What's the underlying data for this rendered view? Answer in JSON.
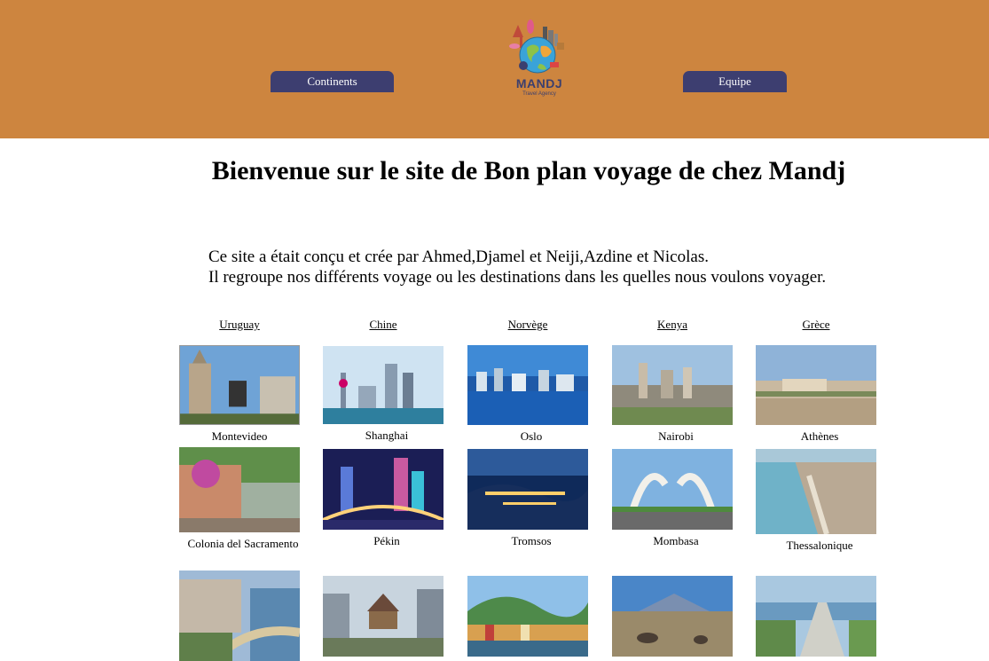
{
  "header": {
    "bg_color": "#cd853f",
    "button_color": "#3d3e70",
    "nav_continents": "Continents",
    "nav_equipe": "Equipe",
    "logo_brand": "MANDJ",
    "logo_tagline": "Travel Agency"
  },
  "main": {
    "title": "Bienvenue sur le site de Bon plan voyage de chez Mandj",
    "intro_line1": "Ce site a était conçu et crée par Ahmed,Djamel et Neiji,Azdine et Nicolas.",
    "intro_line2": "Il regroupe nos différents voyage ou les destinations dans les quelles nous voulons voyager."
  },
  "countries": [
    "Uruguay",
    "Chine",
    "Norvège",
    "Kenya",
    "Grèce"
  ],
  "cities": {
    "row1": [
      "Montevideo",
      "Shanghai",
      "Oslo",
      "Nairobi",
      "Athènes"
    ],
    "row2": [
      "Colonia del Sacramento",
      "Pékin",
      "Tromsos",
      "Mombasa",
      "Thessalonique"
    ]
  }
}
